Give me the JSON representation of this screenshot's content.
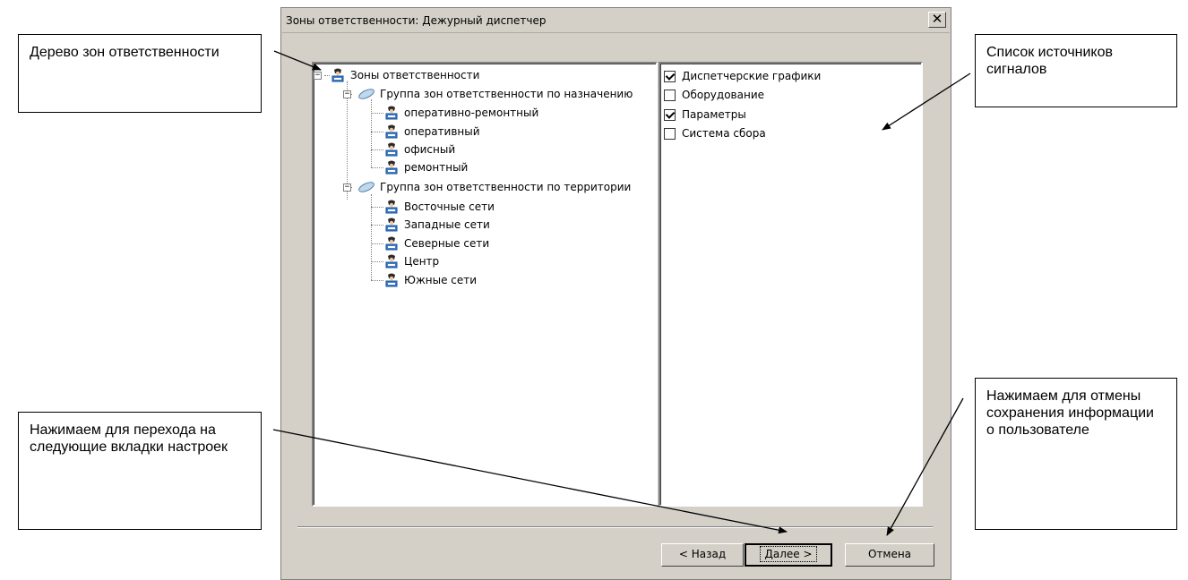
{
  "dialog": {
    "title": "Зоны ответственности: Дежурный диспетчер",
    "close_symbol": "✕"
  },
  "tree": {
    "root": "Зоны ответственности",
    "groups": [
      {
        "label": "Группа зон ответственности по назначению",
        "items": [
          "оперативно-ремонтный",
          "оперативный",
          "офисный",
          "ремонтный"
        ]
      },
      {
        "label": "Группа зон ответственности по территории",
        "items": [
          "Восточные сети",
          "Западные сети",
          "Северные сети",
          "Центр",
          "Южные сети"
        ]
      }
    ],
    "expander_symbol": "−"
  },
  "sources": [
    {
      "label": "Диспетчерские графики",
      "checked": true
    },
    {
      "label": "Оборудование",
      "checked": false
    },
    {
      "label": "Параметры",
      "checked": true
    },
    {
      "label": "Система сбора",
      "checked": false
    }
  ],
  "buttons": {
    "back": "< Назад",
    "next": "Далее >",
    "cancel": "Отмена"
  },
  "callouts": {
    "tree": "Дерево зон ответственности",
    "sources": "Список источников сигналов",
    "next": "Нажимаем для перехода на следующие вкладки настроек",
    "cancel": "Нажимаем для отмены сохранения информации о пользователе"
  },
  "colors": {
    "dialog_bg": "#d4d0c8",
    "panel_bg": "#ffffff"
  },
  "icons": {
    "zone": "zone-icon",
    "group": "group-icon",
    "close": "close-icon"
  }
}
